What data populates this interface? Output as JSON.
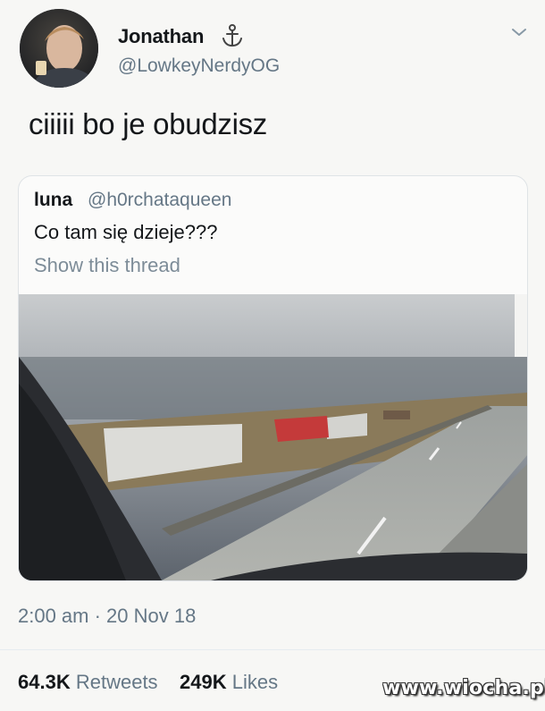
{
  "tweet": {
    "author": {
      "display_name": "Jonathan",
      "badge_icon": "anchor-icon",
      "handle": "@LowkeyNerdyOG"
    },
    "menu_icon": "chevron-down-icon",
    "text": "ciiiii bo je obudzisz",
    "quoted_tweet": {
      "display_name": "luna",
      "handle": "@h0rchataqueen",
      "text": "Co tam się dzieje???",
      "show_thread_label": "Show this thread",
      "media": "photo of a highway with overturned red truck seen through a car windshield"
    },
    "timestamp": "2:00 am · 20 Nov 18",
    "stats": {
      "retweets_count": "64.3K",
      "retweets_label": "Retweets",
      "likes_count": "249K",
      "likes_label": "Likes"
    }
  },
  "watermark": "www.wiocha.pl",
  "colors": {
    "text_primary": "#14171a",
    "text_secondary": "#657786",
    "card_border": "#dfe3e6"
  }
}
